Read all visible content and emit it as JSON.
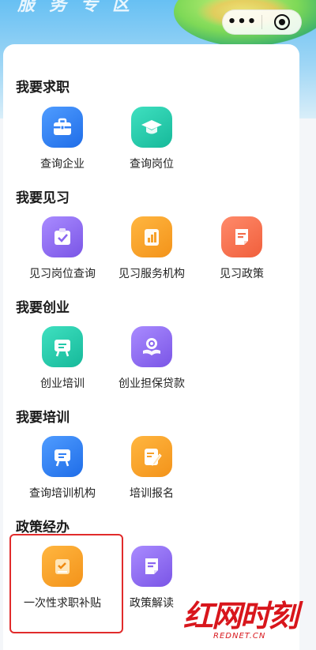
{
  "banner": {
    "title": "服务专区"
  },
  "capsule": {
    "menu_icon": "more-dots-icon",
    "close_icon": "target-icon"
  },
  "sections": [
    {
      "title": "我要求职",
      "items": [
        {
          "label": "查询企业",
          "icon": "briefcase-icon",
          "color": "#2f7ff5"
        },
        {
          "label": "查询岗位",
          "icon": "graduation-cap-icon",
          "color": "#22c8a8"
        }
      ]
    },
    {
      "title": "我要见习",
      "items": [
        {
          "label": "见习岗位查询",
          "icon": "checklist-icon",
          "color": "#8b66f0"
        },
        {
          "label": "见习服务机构",
          "icon": "bar-chart-icon",
          "color": "#f7a12a"
        },
        {
          "label": "见习政策",
          "icon": "document-icon",
          "color": "#f26e4c"
        }
      ]
    },
    {
      "title": "我要创业",
      "items": [
        {
          "label": "创业培训",
          "icon": "easel-icon",
          "color": "#22c8a8"
        },
        {
          "label": "创业担保贷款",
          "icon": "hand-coin-icon",
          "color": "#8b66f0"
        }
      ]
    },
    {
      "title": "我要培训",
      "items": [
        {
          "label": "查询培训机构",
          "icon": "easel-icon",
          "color": "#2f7ff5"
        },
        {
          "label": "培训报名",
          "icon": "edit-form-icon",
          "color": "#f7a12a"
        }
      ]
    },
    {
      "title": "政策经办",
      "items": [
        {
          "label": "一次性求职补贴",
          "icon": "check-file-icon",
          "color": "#f7a12a"
        },
        {
          "label": "政策解读",
          "icon": "document-icon",
          "color": "#8b66f0"
        }
      ]
    }
  ],
  "watermark": {
    "text": "红网时刻",
    "sub": "REDNET.CN"
  }
}
